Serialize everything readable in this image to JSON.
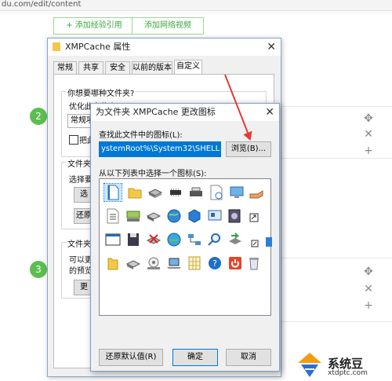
{
  "browser": {
    "url": "du.com/edit/content"
  },
  "editor": {
    "add_citation_label": "+ 添加经验引用",
    "add_video_label": "添加网络视频",
    "step2_num": "2",
    "step3_num": "3"
  },
  "properties_dialog": {
    "title": "XMPCache 属性",
    "tabs": [
      "常规",
      "共享",
      "安全",
      "以前的版本",
      "自定义"
    ],
    "q_folder_type": "你想要哪种文件夹?",
    "optimize_label": "优化此文件夹(T):",
    "optimize_value": "常规项",
    "apply_subfolders_label": "把此",
    "folder_pics_label": "文件夹图",
    "select_label": "选择要在",
    "choose_file_btn": "选",
    "restore_btn": "还原",
    "folder_icon_label": "文件夹图",
    "folder_icon_desc1": "可以更改",
    "folder_icon_desc2": "的预览。",
    "change_icon_btn": "更"
  },
  "icon_dialog": {
    "title": "为文件夹 XMPCache 更改图标",
    "find_label": "查找此文件中的图标(L):",
    "path_value": "ystemRoot%\\System32\\SHELL32.dll",
    "browse_btn": "浏览(B)...",
    "list_label": "从以下列表中选择一个图标(S):",
    "restore_default_btn": "还原默认值(R)",
    "ok_btn": "确定",
    "cancel_btn": "取消"
  },
  "watermark": {
    "brand": "系统豆",
    "url": "xtdptc.com"
  },
  "colors": {
    "accent_green": "#5bbf4f",
    "selection_blue": "#0078d7",
    "arrow_red": "#e53935"
  }
}
